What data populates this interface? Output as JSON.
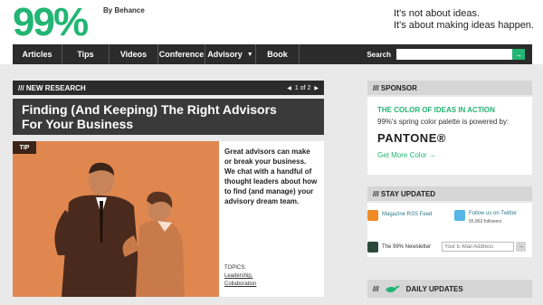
{
  "header": {
    "logo": "99%",
    "byline": "By Behance",
    "tagline_1": "It's not about ideas.",
    "tagline_2": "It's about making ideas happen."
  },
  "nav": {
    "items": [
      {
        "label": "Articles"
      },
      {
        "label": "Tips"
      },
      {
        "label": "Videos"
      },
      {
        "label": "Conference"
      },
      {
        "label": "Advisory"
      },
      {
        "label": "Book"
      }
    ],
    "search_label": "Search",
    "search_placeholder": "",
    "search_button": "→"
  },
  "feature": {
    "section_title": "/// NEW RESEARCH",
    "pager": "1 of 2",
    "title": "Finding (And Keeping) The Right Advisors For Your Business",
    "badge": "TIP",
    "description": "Great advisors can make or break your business. We chat with a handful of thought leaders about how to find (and manage) your advisory dream team.",
    "topics_label": "TOPICS:",
    "topics": [
      "Leadership,",
      "Collaboration"
    ]
  },
  "sidebar": {
    "sponsor_title": "/// SPONSOR",
    "sponsor_headline": "THE COLOR OF IDEAS IN ACTION",
    "sponsor_sub": "99%'s spring color palette is powered by:",
    "sponsor_brand": "PANTONE®",
    "sponsor_link": "Get More Color →",
    "updated_title": "/// STAY UPDATED",
    "rss_label": "Magazine RSS Feed",
    "twitter_label": "Follow us on Twitter",
    "twitter_count": "55,863 followers",
    "newsletter_label": "The 99% Newsletter",
    "email_placeholder": "Your E-Mail Address",
    "email_button": "→",
    "daily_title_prefix": "///",
    "daily_title": "DAILY UPDATES"
  },
  "colors": {
    "brand_green": "#22b573",
    "nav_dark": "#2b2b2b",
    "feature_orange": "#e0874f"
  }
}
